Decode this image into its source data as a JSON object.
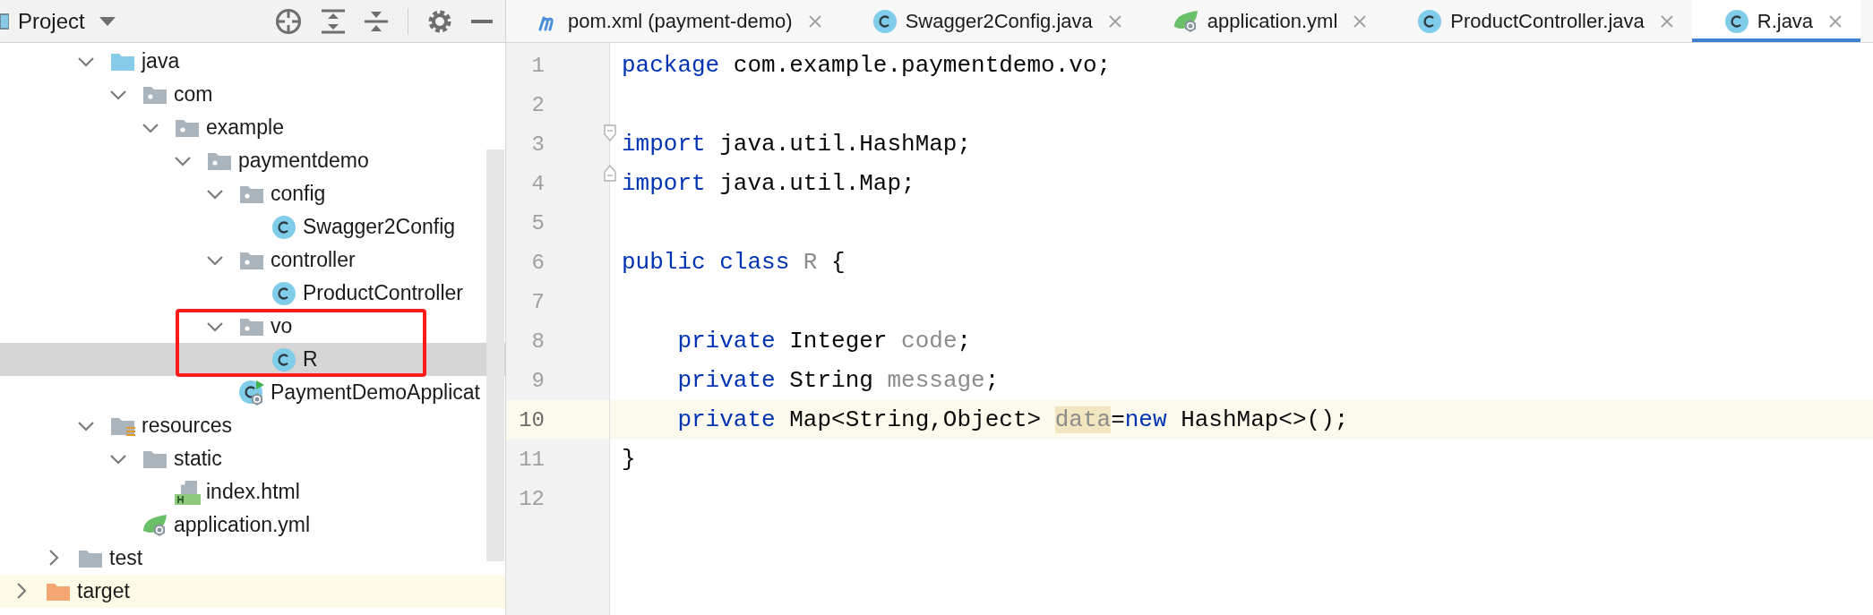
{
  "project_panel": {
    "title": "Project",
    "tree": [
      {
        "children": [
          {
            "children": [
              {
                "label": "java",
                "kind": "source-root",
                "expanded": true,
                "selected": false,
                "children": [
                  {
                    "label": "com",
                    "kind": "package",
                    "expanded": true,
                    "selected": false,
                    "children": [
                      {
                        "label": "example",
                        "kind": "package",
                        "expanded": true,
                        "selected": false,
                        "children": [
                          {
                            "label": "paymentdemo",
                            "kind": "package",
                            "expanded": true,
                            "selected": false,
                            "children": [
                              {
                                "label": "config",
                                "kind": "package",
                                "expanded": true,
                                "selected": false,
                                "children": [
                                  {
                                    "label": "Swagger2Config",
                                    "kind": "class",
                                    "selected": false
                                  }
                                ]
                              },
                              {
                                "label": "controller",
                                "kind": "package",
                                "expanded": true,
                                "selected": false,
                                "children": [
                                  {
                                    "label": "ProductController",
                                    "kind": "class",
                                    "selected": false
                                  }
                                ]
                              },
                              {
                                "label": "vo",
                                "kind": "package",
                                "expanded": true,
                                "selected": false,
                                "annotated": true,
                                "children": [
                                  {
                                    "label": "R",
                                    "kind": "class",
                                    "selected": true
                                  }
                                ]
                              },
                              {
                                "label": "PaymentDemoApplicat",
                                "kind": "spring-app",
                                "selected": false
                              }
                            ]
                          }
                        ]
                      }
                    ]
                  }
                ]
              },
              {
                "label": "resources",
                "kind": "resources-root",
                "expanded": true,
                "selected": false,
                "children": [
                  {
                    "label": "static",
                    "kind": "folder",
                    "expanded": true,
                    "selected": false,
                    "children": [
                      {
                        "label": "index.html",
                        "kind": "html",
                        "selected": false
                      }
                    ]
                  },
                  {
                    "label": "application.yml",
                    "kind": "spring-yml",
                    "selected": false
                  }
                ]
              }
            ]
          },
          {
            "label": "test",
            "kind": "folder",
            "expanded": false,
            "selected": false
          }
        ]
      },
      {
        "label": "target",
        "kind": "excluded-folder",
        "expanded": false,
        "selected": false
      }
    ]
  },
  "tabs": [
    {
      "label": "pom.xml (payment-demo)",
      "kind": "maven",
      "selected": false
    },
    {
      "label": "Swagger2Config.java",
      "kind": "class",
      "selected": false
    },
    {
      "label": "application.yml",
      "kind": "spring-yml",
      "selected": false
    },
    {
      "label": "ProductController.java",
      "kind": "class",
      "selected": false
    },
    {
      "label": "R.java",
      "kind": "class",
      "selected": true
    }
  ],
  "editor": {
    "lines": [
      {
        "number": "1",
        "current": false,
        "tokens": [
          {
            "kind": "keyword",
            "text": "package"
          },
          {
            "kind": "plain",
            "text": " com.example.paymentdemo.vo;"
          }
        ]
      },
      {
        "number": "2",
        "current": false
      },
      {
        "number": "3",
        "current": false,
        "fold_start": true,
        "tokens": [
          {
            "kind": "keyword",
            "text": "import"
          },
          {
            "kind": "plain",
            "text": " java.util.HashMap;"
          }
        ]
      },
      {
        "number": "4",
        "current": false,
        "fold_end": true,
        "tokens": [
          {
            "kind": "keyword",
            "text": "import"
          },
          {
            "kind": "plain",
            "text": " java.util.Map;"
          }
        ]
      },
      {
        "number": "5",
        "current": false
      },
      {
        "number": "6",
        "current": false,
        "tokens": [
          {
            "kind": "keyword",
            "text": "public class "
          },
          {
            "kind": "unused",
            "text": "R"
          },
          {
            "kind": "plain",
            "text": " {"
          }
        ]
      },
      {
        "number": "7",
        "current": false
      },
      {
        "number": "8",
        "current": false,
        "tokens": [
          {
            "kind": "keyword",
            "text": "    private"
          },
          {
            "kind": "plain",
            "text": " Integer "
          },
          {
            "kind": "unused",
            "text": "code"
          },
          {
            "kind": "plain",
            "text": ";"
          }
        ]
      },
      {
        "number": "9",
        "current": false,
        "tokens": [
          {
            "kind": "keyword",
            "text": "    private"
          },
          {
            "kind": "plain",
            "text": " String "
          },
          {
            "kind": "unused",
            "text": "message"
          },
          {
            "kind": "plain",
            "text": ";"
          }
        ]
      },
      {
        "number": "10",
        "current": true,
        "tokens": [
          {
            "kind": "keyword",
            "text": "    private"
          },
          {
            "kind": "plain",
            "text": " Map<String,Object> "
          },
          {
            "kind": "unused-highlighted",
            "text": "data"
          },
          {
            "kind": "plain",
            "text": "="
          },
          {
            "kind": "keyword",
            "text": "new"
          },
          {
            "kind": "plain",
            "text": " HashMap<>();"
          }
        ]
      },
      {
        "number": "11",
        "current": false,
        "tokens": [
          {
            "kind": "plain",
            "text": "}"
          }
        ]
      },
      {
        "number": "12",
        "current": false
      }
    ]
  }
}
